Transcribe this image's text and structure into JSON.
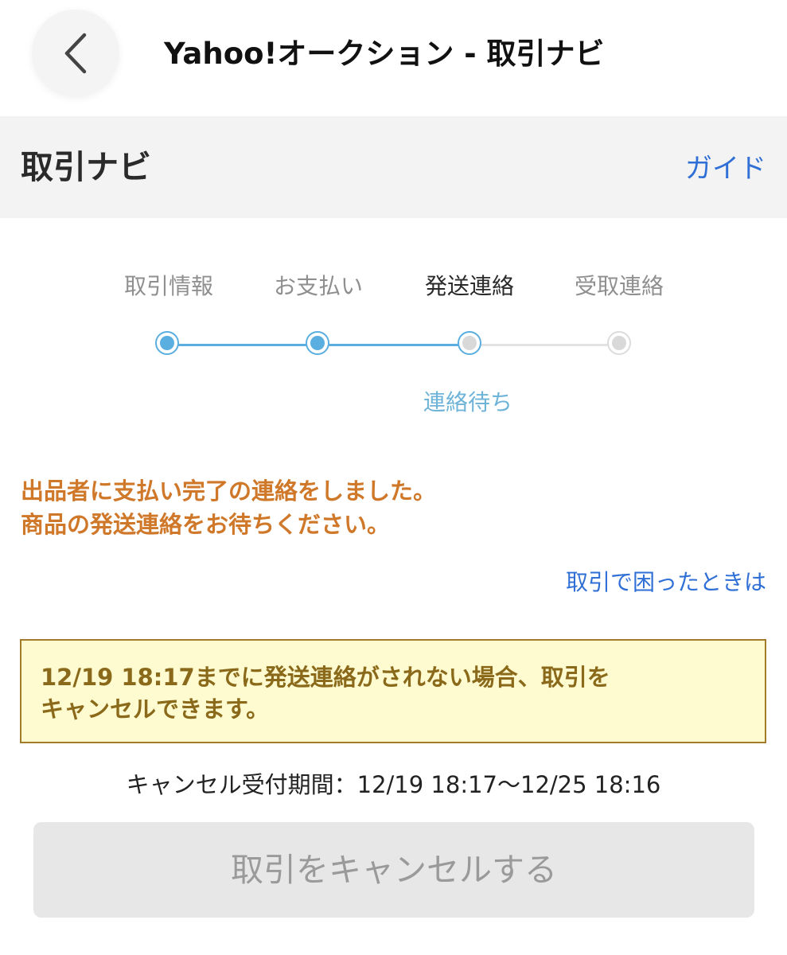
{
  "topbar": {
    "title": "Yahoo!オークション - 取引ナビ",
    "back_icon": "chevron-left-icon"
  },
  "section": {
    "title": "取引ナビ",
    "guide_label": "ガイド"
  },
  "stepper": {
    "steps": [
      {
        "label": "取引情報",
        "state": "done"
      },
      {
        "label": "お支払い",
        "state": "done"
      },
      {
        "label": "発送連絡",
        "state": "current"
      },
      {
        "label": "受取連絡",
        "state": "todo"
      }
    ],
    "current_status": "連絡待ち"
  },
  "message": {
    "line1": "出品者に支払い完了の連絡をしました。",
    "line2": "商品の発送連絡をお待ちください。"
  },
  "help_link": "取引で困ったときは",
  "notice": {
    "line1": "12/19 18:17までに発送連絡がされない場合、取引を",
    "line2": "キャンセルできます。"
  },
  "cancel_period": "キャンセル受付期間：12/19 18:17〜12/25 18:16",
  "cancel_button_label": "取引をキャンセルする",
  "colors": {
    "accent_blue": "#5aaee0",
    "link_blue": "#2f6fd6",
    "message_orange": "#d0782a",
    "notice_bg": "#fffbd0",
    "notice_border": "#a27c2a",
    "inactive_gray": "#dcdcdc"
  }
}
